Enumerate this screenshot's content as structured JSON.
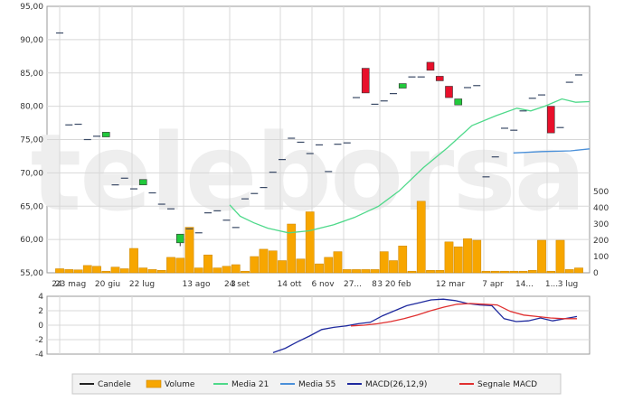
{
  "chart_data": [
    {
      "type": "candlestick",
      "watermark": "teleborsa",
      "y_price_ticks": [
        "95,00",
        "90,00",
        "85,00",
        "80,00",
        "75,00",
        "70,00",
        "65,00",
        "60,00",
        "55,00"
      ],
      "price_range": [
        55,
        95
      ],
      "y_volume_ticks": [
        "500",
        "400",
        "300",
        "200",
        "100",
        "0"
      ],
      "volume_range": [
        0,
        500
      ],
      "x_tick_labels": [
        "24",
        "23 mag",
        "20 giu",
        "22 lug",
        "13 ago",
        "24 set",
        "3",
        "14 ott",
        "6 nov",
        "27...",
        "8",
        "3 20 feb",
        "12 mar",
        "7 apr",
        "14...",
        "1...",
        "3 lug"
      ],
      "grid": true,
      "candles": [
        {
          "o": 91.0,
          "h": 91.0,
          "l": 91.0,
          "c": 91.0,
          "color": "flat"
        },
        {
          "o": 77.2,
          "h": 77.2,
          "l": 77.2,
          "c": 77.2,
          "color": "flat"
        },
        {
          "o": 77.3,
          "h": 77.3,
          "l": 77.3,
          "c": 77.3,
          "color": "flat"
        },
        {
          "o": 75.0,
          "h": 75.0,
          "l": 75.0,
          "c": 75.0,
          "color": "flat"
        },
        {
          "o": 75.5,
          "h": 75.5,
          "l": 75.5,
          "c": 75.5,
          "color": "flat"
        },
        {
          "o": 75.4,
          "h": 76.1,
          "l": 75.4,
          "c": 76.1,
          "color": "up"
        },
        {
          "o": 68.2,
          "h": 68.2,
          "l": 68.2,
          "c": 68.2,
          "color": "flat"
        },
        {
          "o": 69.2,
          "h": 69.2,
          "l": 69.2,
          "c": 69.2,
          "color": "flat"
        },
        {
          "o": 67.6,
          "h": 67.6,
          "l": 67.6,
          "c": 67.6,
          "color": "flat"
        },
        {
          "o": 68.2,
          "h": 69.0,
          "l": 68.2,
          "c": 69.0,
          "color": "up"
        },
        {
          "o": 67.0,
          "h": 67.0,
          "l": 67.0,
          "c": 67.0,
          "color": "flat"
        },
        {
          "o": 65.3,
          "h": 65.3,
          "l": 65.3,
          "c": 65.3,
          "color": "flat"
        },
        {
          "o": 64.6,
          "h": 64.6,
          "l": 64.6,
          "c": 64.6,
          "color": "flat"
        },
        {
          "o": 59.5,
          "h": 60.8,
          "l": 59.0,
          "c": 60.8,
          "color": "up"
        },
        {
          "o": 61.6,
          "h": 61.6,
          "l": 61.6,
          "c": 61.6,
          "color": "flat"
        },
        {
          "o": 61.0,
          "h": 61.2,
          "l": 60.5,
          "c": 61.0,
          "color": "flat"
        },
        {
          "o": 64.0,
          "h": 64.0,
          "l": 64.0,
          "c": 64.0,
          "color": "flat"
        },
        {
          "o": 64.3,
          "h": 64.3,
          "l": 64.3,
          "c": 64.3,
          "color": "flat"
        },
        {
          "o": 62.9,
          "h": 62.9,
          "l": 62.9,
          "c": 62.9,
          "color": "flat"
        },
        {
          "o": 61.8,
          "h": 61.8,
          "l": 61.8,
          "c": 61.8,
          "color": "flat"
        },
        {
          "o": 66.1,
          "h": 66.1,
          "l": 66.1,
          "c": 66.1,
          "color": "flat"
        },
        {
          "o": 66.9,
          "h": 66.9,
          "l": 66.9,
          "c": 66.9,
          "color": "flat"
        },
        {
          "o": 67.8,
          "h": 67.8,
          "l": 67.8,
          "c": 67.8,
          "color": "flat"
        },
        {
          "o": 70.1,
          "h": 70.1,
          "l": 70.1,
          "c": 70.1,
          "color": "flat"
        },
        {
          "o": 72.0,
          "h": 72.0,
          "l": 72.0,
          "c": 72.0,
          "color": "flat"
        },
        {
          "o": 75.2,
          "h": 75.2,
          "l": 75.2,
          "c": 75.2,
          "color": "flat"
        },
        {
          "o": 74.6,
          "h": 74.6,
          "l": 74.6,
          "c": 74.6,
          "color": "flat"
        },
        {
          "o": 72.9,
          "h": 72.9,
          "l": 72.9,
          "c": 72.9,
          "color": "flat"
        },
        {
          "o": 74.2,
          "h": 74.2,
          "l": 74.2,
          "c": 74.2,
          "color": "flat"
        },
        {
          "o": 70.2,
          "h": 70.2,
          "l": 70.2,
          "c": 70.2,
          "color": "flat"
        },
        {
          "o": 74.3,
          "h": 74.3,
          "l": 74.3,
          "c": 74.3,
          "color": "flat"
        },
        {
          "o": 74.5,
          "h": 74.5,
          "l": 74.5,
          "c": 74.5,
          "color": "flat"
        },
        {
          "o": 81.3,
          "h": 81.3,
          "l": 81.3,
          "c": 81.3,
          "color": "flat"
        },
        {
          "o": 85.7,
          "h": 85.7,
          "l": 82.0,
          "c": 82.0,
          "color": "down"
        },
        {
          "o": 80.3,
          "h": 80.3,
          "l": 80.3,
          "c": 80.3,
          "color": "flat"
        },
        {
          "o": 80.8,
          "h": 80.8,
          "l": 80.8,
          "c": 80.8,
          "color": "flat"
        },
        {
          "o": 81.9,
          "h": 81.9,
          "l": 81.9,
          "c": 81.9,
          "color": "flat"
        },
        {
          "o": 82.8,
          "h": 83.4,
          "l": 82.8,
          "c": 83.4,
          "color": "up"
        },
        {
          "o": 84.4,
          "h": 84.4,
          "l": 84.4,
          "c": 84.4,
          "color": "flat"
        },
        {
          "o": 84.4,
          "h": 84.4,
          "l": 84.4,
          "c": 84.4,
          "color": "flat"
        },
        {
          "o": 86.6,
          "h": 86.6,
          "l": 85.4,
          "c": 85.4,
          "color": "down"
        },
        {
          "o": 84.5,
          "h": 84.5,
          "l": 84.3,
          "c": 84.3,
          "color": "down"
        },
        {
          "o": 83.0,
          "h": 83.0,
          "l": 81.3,
          "c": 81.3,
          "color": "down"
        },
        {
          "o": 80.2,
          "h": 81.1,
          "l": 80.2,
          "c": 81.1,
          "color": "up"
        },
        {
          "o": 82.8,
          "h": 82.8,
          "l": 82.8,
          "c": 82.8,
          "color": "flat"
        },
        {
          "o": 83.1,
          "h": 83.1,
          "l": 83.1,
          "c": 83.1,
          "color": "flat"
        },
        {
          "o": 69.4,
          "h": 69.4,
          "l": 69.4,
          "c": 69.4,
          "color": "flat"
        },
        {
          "o": 72.4,
          "h": 72.4,
          "l": 72.4,
          "c": 72.4,
          "color": "flat"
        },
        {
          "o": 76.7,
          "h": 76.7,
          "l": 76.7,
          "c": 76.7,
          "color": "flat"
        },
        {
          "o": 76.4,
          "h": 76.4,
          "l": 76.4,
          "c": 76.4,
          "color": "flat"
        },
        {
          "o": 79.3,
          "h": 79.3,
          "l": 79.3,
          "c": 79.3,
          "color": "flat"
        },
        {
          "o": 81.2,
          "h": 81.2,
          "l": 81.2,
          "c": 81.2,
          "color": "flat"
        },
        {
          "o": 81.7,
          "h": 81.7,
          "l": 81.7,
          "c": 81.7,
          "color": "flat"
        },
        {
          "o": 80.0,
          "h": 80.0,
          "l": 76.0,
          "c": 76.0,
          "color": "down"
        },
        {
          "o": 76.8,
          "h": 76.8,
          "l": 76.8,
          "c": 76.8,
          "color": "flat"
        },
        {
          "o": 83.6,
          "h": 83.6,
          "l": 83.6,
          "c": 83.6,
          "color": "flat"
        },
        {
          "o": 84.7,
          "h": 84.7,
          "l": 84.7,
          "c": 84.7,
          "color": "flat"
        }
      ],
      "volume": [
        25,
        20,
        18,
        45,
        40,
        10,
        35,
        25,
        150,
        30,
        20,
        15,
        95,
        90,
        280,
        30,
        110,
        30,
        40,
        50,
        10,
        100,
        145,
        135,
        75,
        300,
        85,
        375,
        55,
        95,
        130,
        20,
        20,
        20,
        20,
        130,
        75,
        165,
        10,
        440,
        15,
        15,
        190,
        160,
        210,
        200,
        10,
        10,
        10,
        10,
        10,
        15,
        200,
        10,
        200,
        20,
        30,
        10,
        100
      ],
      "media21": [
        [
          0.0,
          65.2
        ],
        [
          0.03,
          63.5
        ],
        [
          0.07,
          62.5
        ],
        [
          0.11,
          61.7
        ],
        [
          0.17,
          61.0
        ],
        [
          0.23,
          61.3
        ],
        [
          0.3,
          62.2
        ],
        [
          0.36,
          63.3
        ],
        [
          0.43,
          65.0
        ],
        [
          0.49,
          67.3
        ],
        [
          0.56,
          70.8
        ],
        [
          0.63,
          73.8
        ],
        [
          0.7,
          77.1
        ],
        [
          0.77,
          78.6
        ],
        [
          0.83,
          79.7
        ],
        [
          0.87,
          79.3
        ],
        [
          0.91,
          80.0
        ],
        [
          0.96,
          81.1
        ],
        [
          1.0,
          80.6
        ],
        [
          1.04,
          80.7
        ]
      ],
      "media55": [
        [
          0.0,
          73.0
        ],
        [
          0.15,
          73.2
        ],
        [
          0.3,
          73.3
        ],
        [
          0.4,
          73.6
        ]
      ],
      "macd_panel": {
        "y_ticks": [
          "4",
          "2",
          "0",
          "-2",
          "-4"
        ],
        "range": [
          -4,
          4
        ],
        "macd": [
          -3.8,
          -3.2,
          -2.3,
          -1.5,
          -0.6,
          -0.3,
          -0.1,
          0.2,
          0.4,
          1.3,
          2.0,
          2.7,
          3.1,
          3.5,
          3.6,
          3.4,
          3.0,
          2.8,
          2.7,
          0.9,
          0.5,
          0.6,
          1.0,
          0.6,
          0.9,
          1.2
        ],
        "signal": [
          -0.1,
          0.0,
          0.2,
          0.5,
          0.9,
          1.4,
          2.0,
          2.5,
          2.9,
          3.0,
          2.9,
          2.8,
          1.9,
          1.4,
          1.2,
          1.0,
          0.9,
          0.9
        ]
      }
    }
  ],
  "legend": [
    {
      "label": "Candele",
      "color": "#222222",
      "kind": "line"
    },
    {
      "label": "Volume",
      "color": "#F7A600",
      "kind": "bar"
    },
    {
      "label": "Media 21",
      "color": "#4ED98A",
      "kind": "line"
    },
    {
      "label": "Media 55",
      "color": "#4A90D9",
      "kind": "line"
    },
    {
      "label": "MACD(26,12,9)",
      "color": "#1F2A9E",
      "kind": "line"
    },
    {
      "label": "Segnale MACD",
      "color": "#E03030",
      "kind": "line"
    }
  ],
  "colors": {
    "up": "#22C93C",
    "down": "#E8102B",
    "flat": "#3A4A66",
    "volume": "#F7A600",
    "grid": "#D8D8D8",
    "watermark": "#EEEEEE"
  }
}
